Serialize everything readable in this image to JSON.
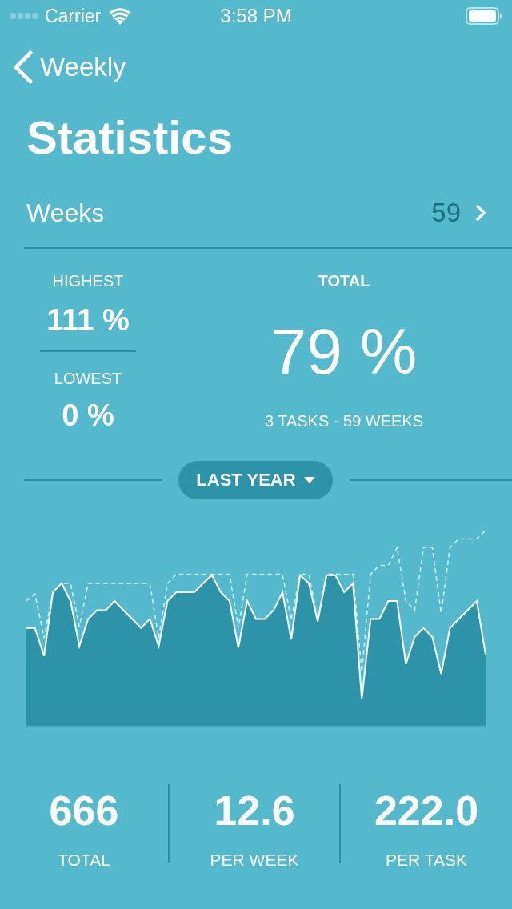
{
  "status_bar": {
    "carrier": "Carrier",
    "time": "3:58 PM"
  },
  "nav": {
    "back_label": "Weekly",
    "title": "Statistics"
  },
  "weeks_row": {
    "label": "Weeks",
    "value": "59"
  },
  "summary": {
    "highest": {
      "label": "HIGHEST",
      "value": "111 %"
    },
    "lowest": {
      "label": "LOWEST",
      "value": "0 %"
    },
    "total": {
      "label": "TOTAL",
      "value": "79 %",
      "detail": "3 TASKS - 59 WEEKS"
    }
  },
  "period_button": {
    "label": "LAST YEAR"
  },
  "totals": [
    {
      "value": "666",
      "label": "TOTAL"
    },
    {
      "value": "12.6",
      "label": "PER WEEK"
    },
    {
      "value": "222.0",
      "label": "PER TASK"
    }
  ]
}
